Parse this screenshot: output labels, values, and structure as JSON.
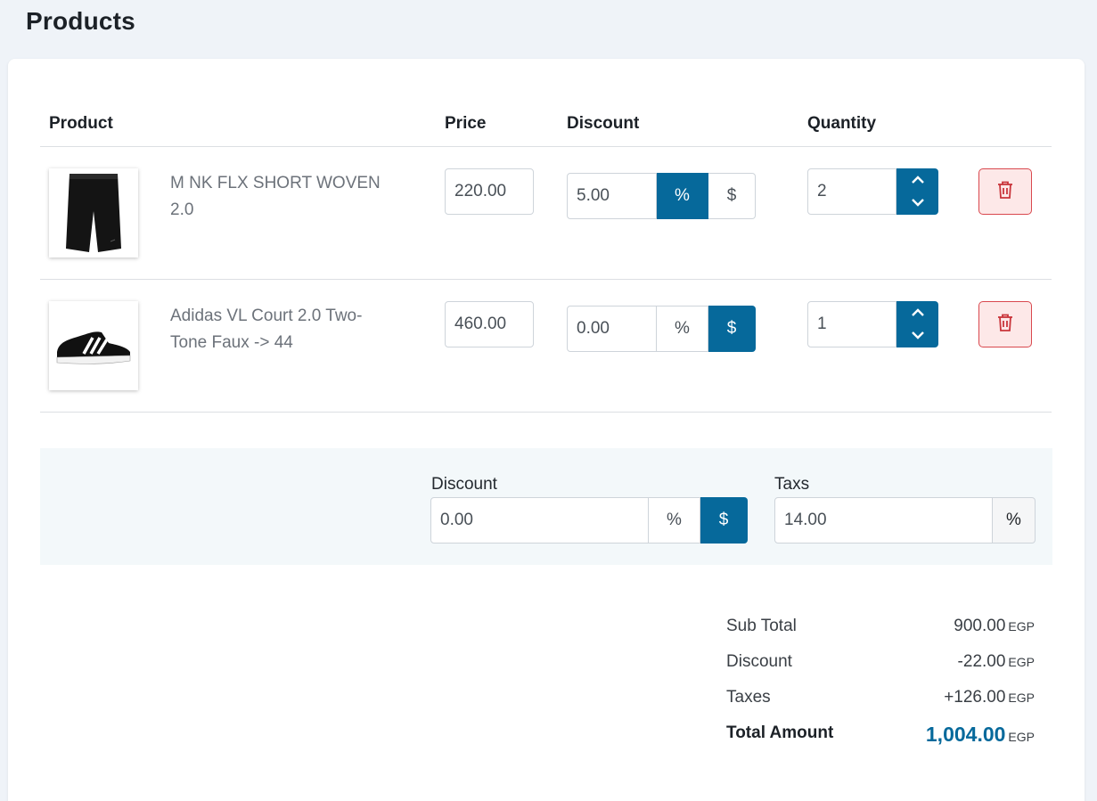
{
  "page": {
    "title": "Products"
  },
  "table": {
    "headers": {
      "product": "Product",
      "price": "Price",
      "discount": "Discount",
      "quantity": "Quantity"
    }
  },
  "rows": [
    {
      "name": "M NK FLX SHORT WOVEN 2.0",
      "image_icon": "shorts-image",
      "price": "220.00",
      "discount_value": "5.00",
      "discount_type_active": "percent",
      "quantity": "2"
    },
    {
      "name": "Adidas VL Court 2.0 Two-Tone Faux -> 44",
      "image_icon": "sneaker-image",
      "price": "460.00",
      "discount_value": "0.00",
      "discount_type_active": "fixed",
      "quantity": "1"
    }
  ],
  "toggle": {
    "percent": "%",
    "fixed": "$"
  },
  "order": {
    "discount_label": "Discount",
    "discount_value": "0.00",
    "discount_type_active": "fixed",
    "taxes_label": "Taxs",
    "taxes_value": "14.00",
    "taxes_unit": "%"
  },
  "totals": {
    "currency": "EGP",
    "sub_total_label": "Sub Total",
    "sub_total": "900.00",
    "discount_label": "Discount",
    "discount": "-22.00",
    "taxes_label": "Taxes",
    "taxes": "+126.00",
    "total_label": "Total Amount",
    "total": "1,004.00"
  },
  "colors": {
    "accent": "#06699b",
    "danger": "#d9484e",
    "danger_bg": "#fde8e8",
    "page_bg": "#eff3f8"
  }
}
